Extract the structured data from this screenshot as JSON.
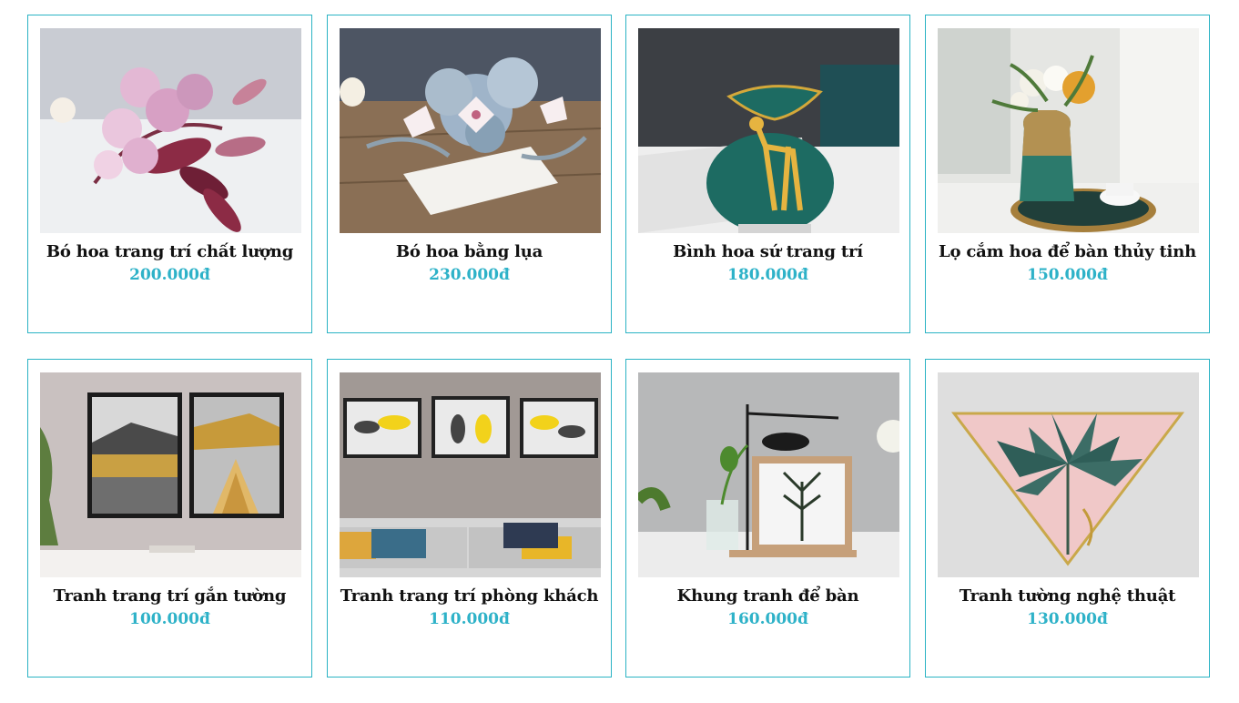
{
  "products": [
    {
      "name": "Bó hoa trang trí chất lượng",
      "price": "200.000đ",
      "image": "pink-flower-bouquet"
    },
    {
      "name": "Bó hoa bằng lụa",
      "price": "230.000đ",
      "image": "silk-flower-bouquet"
    },
    {
      "name": "Bình hoa sứ trang trí",
      "price": "180.000đ",
      "image": "deer-porcelain-vase"
    },
    {
      "name": "Lọ cắm hoa để bàn thủy tinh",
      "price": "150.000đ",
      "image": "glass-table-vase"
    },
    {
      "name": "Tranh trang trí gắn tường",
      "price": "100.000đ",
      "image": "wall-art-landscape"
    },
    {
      "name": "Tranh trang trí phòng khách",
      "price": "110.000đ",
      "image": "living-room-fish-prints"
    },
    {
      "name": "Khung tranh để bàn",
      "price": "160.000đ",
      "image": "desk-photo-frame"
    },
    {
      "name": "Tranh tường nghệ thuật",
      "price": "130.000đ",
      "image": "triangle-leaf-art"
    }
  ],
  "colors": {
    "border": "#2bb3c4",
    "price": "#2eb2c8",
    "title": "#111111"
  }
}
